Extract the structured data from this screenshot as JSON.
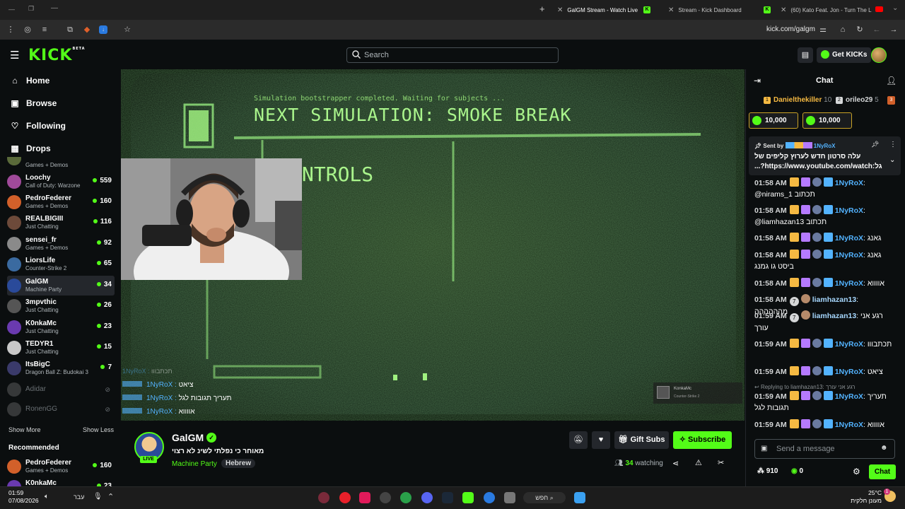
{
  "browser": {
    "tabs": [
      {
        "label": "GalGM Stream - Watch Live",
        "active": true
      },
      {
        "label": "Stream - Kick Dashboard"
      },
      {
        "label": "(60) Kato Feat. Jon - Turn The L"
      }
    ],
    "url": "kick.com/galgm"
  },
  "header": {
    "logo": "KICK",
    "beta": "BETA",
    "search_placeholder": "Search",
    "get_kicks": "Get KICKs"
  },
  "sidebar": {
    "nav": [
      {
        "label": "Home",
        "icon": "home-icon"
      },
      {
        "label": "Browse",
        "icon": "browse-icon"
      },
      {
        "label": "Following",
        "icon": "heart-icon"
      },
      {
        "label": "Drops",
        "icon": "drops-icon"
      }
    ],
    "partial_category": "Games + Demos",
    "channels": [
      {
        "name": "Loochy",
        "category": "Call of Duty: Warzone",
        "viewers": "559",
        "color": "#a04a9a"
      },
      {
        "name": "PedroFederer",
        "category": "Games + Demos",
        "viewers": "160",
        "color": "#d2602a"
      },
      {
        "name": "REALBIGIII",
        "category": "Just Chatting",
        "viewers": "116",
        "color": "#6d4a3a"
      },
      {
        "name": "sensei_fr",
        "category": "Games + Demos",
        "viewers": "92",
        "color": "#8a8a8a"
      },
      {
        "name": "LiorsLife",
        "category": "Counter-Strike 2",
        "viewers": "65",
        "color": "#3a6aa0"
      },
      {
        "name": "GalGM",
        "category": "Machine Party",
        "viewers": "34",
        "color": "#2a4a9a"
      },
      {
        "name": "3mpvthic",
        "category": "Just Chatting",
        "viewers": "26",
        "color": "#555"
      },
      {
        "name": "K0nkaMc",
        "category": "Just Chatting",
        "viewers": "23",
        "color": "#6a3ab0"
      },
      {
        "name": "TEDYR1",
        "category": "Just Chatting",
        "viewers": "15",
        "color": "#c8c8c8"
      },
      {
        "name": "ItsBigC",
        "category": "Dragon Ball Z: Budokai 3",
        "viewers": "7",
        "color": "#3a3a6a"
      }
    ],
    "offline": [
      "Adidar",
      "RonenGG"
    ],
    "show_more": "Show More",
    "show_less": "Show Less",
    "recommended_title": "Recommended",
    "recommended": [
      {
        "name": "PedroFederer",
        "category": "Games + Demos",
        "viewers": "160",
        "color": "#d2602a"
      },
      {
        "name": "K0nkaMc",
        "category": "",
        "viewers": "23",
        "color": "#6a3ab0"
      }
    ]
  },
  "video": {
    "line1": "Simulation bootstrapper completed. Waiting for subjects ...",
    "headline": "NEXT SIMULATION: SMOKE BREAK",
    "controls": "NTROLS",
    "overlay_chat": [
      {
        "user": "1NyRoX",
        "text": "תכתבווו"
      },
      {
        "user": "1NyRoX",
        "text": "ציאט"
      },
      {
        "user": "1NyRoX",
        "text": "תעריך תגובות לגל"
      },
      {
        "user": "1NyRoX",
        "text": "אווווא"
      }
    ],
    "toast_name": "KonkaMc",
    "toast_sub": "Counter-Strike 2"
  },
  "stream": {
    "channel": "GalGM",
    "live": "LIVE",
    "title": "מאוחר כי נפלתי לשינ לא רצוי",
    "category": "Machine Party",
    "tag": "Hebrew",
    "gift_subs": "Gift Subs",
    "subscribe": "Subscribe",
    "watching_count": "34",
    "watching_label": "watching"
  },
  "chat": {
    "title": "Chat",
    "gifters": [
      {
        "rank": "1",
        "name": "Danielthekiller",
        "count": "10"
      },
      {
        "rank": "2",
        "name": "orileo29",
        "count": "5"
      }
    ],
    "kicks": [
      "10,000",
      "10,000"
    ],
    "pinned_sent_by": "Sent by",
    "pinned_user": "1NyRoX",
    "pinned_text": "עלה סרטון חדש לערוץ קליפים של גל:https://www.youtube.com/watch?...",
    "messages": [
      {
        "time": "01:58 AM",
        "user": "1NyRoX",
        "text": "@nirams_1 תכתוב",
        "badge": "crown"
      },
      {
        "time": "01:58 AM",
        "user": "1NyRoX",
        "text": "@liamhazan13 תכתוב",
        "badge": "crown"
      },
      {
        "time": "01:58 AM",
        "user": "1NyRoX",
        "text": "גאנג",
        "badge": "crown"
      },
      {
        "time": "01:58 AM",
        "user": "1NyRoX",
        "text": "גאנג ביסט גו גמנג",
        "badge": "crown"
      },
      {
        "time": "01:58 AM",
        "user": "1NyRoX",
        "text": "אווווא",
        "badge": "crown"
      },
      {
        "time": "01:58 AM",
        "user": "liamhazan13",
        "text": "מהההההה",
        "badge": "seven"
      },
      {
        "time": "01:59 AM",
        "user": "liamhazan13",
        "text": "רגע אני עורך",
        "badge": "seven"
      },
      {
        "time": "01:59 AM",
        "user": "1NyRoX",
        "text": "תכתבווו",
        "badge": "crown"
      },
      {
        "time": "01:59 AM",
        "user": "1NyRoX",
        "text": "ציאט",
        "badge": "crown"
      },
      {
        "time": "01:59 AM",
        "user": "1NyRoX",
        "text": "תעריך תגובות לגל",
        "badge": "crown"
      },
      {
        "time": "01:59 AM",
        "user": "1NyRoX",
        "text": "אווווא",
        "badge": "crown"
      }
    ],
    "replying": "Replying to liamhazan13: רגע אני עורך",
    "input_placeholder": "Send a message",
    "points": "910",
    "kicks_count": "0",
    "send": "Chat"
  },
  "taskbar": {
    "time": "01:59",
    "date": "07/08/2026",
    "lang": "עבר",
    "search": "חפש",
    "temp": "25°C",
    "weather": "מעונן חלקית",
    "notif": "1"
  },
  "colors": {
    "accent": "#53fc18",
    "bg": "#0b0e0f",
    "panel": "#24272c",
    "chat_user": "#53b3ff"
  }
}
